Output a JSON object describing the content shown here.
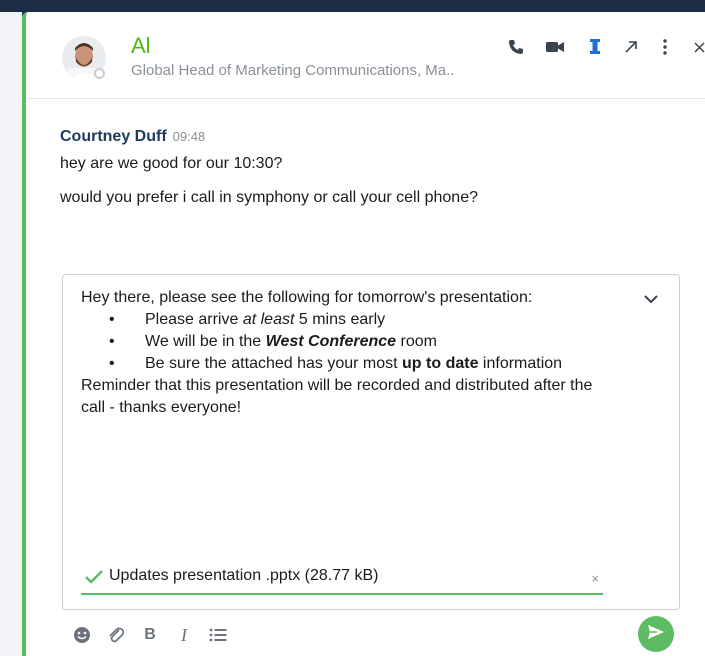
{
  "contact": {
    "name": "Al",
    "title": "Global Head of Marketing Communications, Ma.."
  },
  "header_icons": [
    "phone-icon",
    "video-icon",
    "pin-icon",
    "popout-icon",
    "more-icon",
    "close-icon"
  ],
  "message": {
    "sender": "Courtney Duff",
    "time": "09:48",
    "lines": [
      "hey are we good for our 10:30?",
      "would you prefer i call in symphony or call your cell phone?"
    ]
  },
  "composer": {
    "intro": "Hey there, please see the following for tomorrow's presentation:",
    "bullets": {
      "b1_pre": "Please arrive ",
      "b1_em": "at least",
      "b1_post": " 5 mins early",
      "b2_pre": "We will be in the ",
      "b2_em": "West Conference",
      "b2_post": " room",
      "b3_pre": "Be sure the attached has your most ",
      "b3_strong": "up to date",
      "b3_post": " information"
    },
    "outro": "Reminder that this presentation will be recorded and distributed after the call - thanks everyone!",
    "attachment": {
      "label": "Updates presentation .pptx (28.77 kB)",
      "remove": "×"
    }
  },
  "toolbar": {
    "bold": "B",
    "italic": "I"
  },
  "colors": {
    "accent": "#5dbb63",
    "contact_name": "#4cbb17",
    "pin": "#1f6fd6",
    "sender": "#1d3a5f"
  }
}
